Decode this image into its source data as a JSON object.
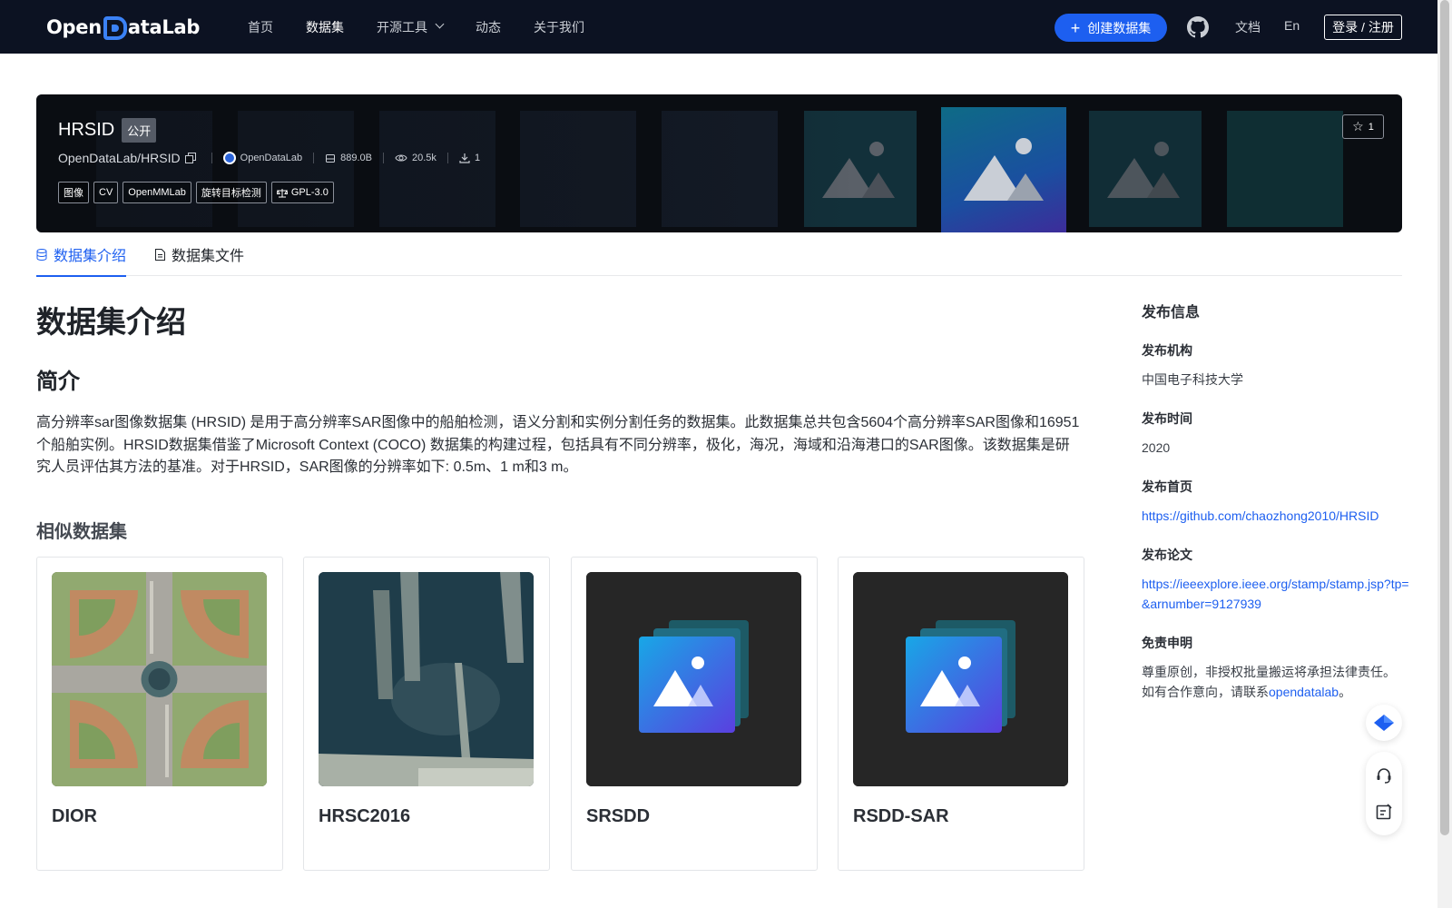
{
  "nav": {
    "logo_text_left": "Open",
    "logo_text_right": "ataLab",
    "links": [
      "首页",
      "数据集",
      "开源工具",
      "动态",
      "关于我们"
    ],
    "create_button": "创建数据集",
    "docs": "文档",
    "lang": "En",
    "login": "登录 / 注册"
  },
  "dataset": {
    "name": "HRSID",
    "visibility": "公开",
    "repo": "OpenDataLab/HRSID",
    "org": "OpenDataLab",
    "size": "889.0B",
    "views": "20.5k",
    "downloads": "1",
    "tags": [
      "图像",
      "CV",
      "OpenMMLab",
      "旋转目标检测"
    ],
    "license": "GPL-3.0",
    "stars": "1"
  },
  "tabs": [
    "数据集介绍",
    "数据集文件"
  ],
  "content": {
    "title": "数据集介绍",
    "section_title": "简介",
    "intro": "高分辨率sar图像数据集 (HRSID) 是用于高分辨率SAR图像中的船舶检测，语义分割和实例分割任务的数据集。此数据集总共包含5604个高分辨率SAR图像和16951个船舶实例。HRSID数据集借鉴了Microsoft Context (COCO) 数据集的构建过程，包括具有不同分辨率，极化，海况，海域和沿海港口的SAR图像。该数据集是研究人员评估其方法的基准。对于HRSID，SAR图像的分辨率如下: 0.5m、1 m和3 m。",
    "similar_title": "相似数据集",
    "similar": [
      {
        "name": "DIOR"
      },
      {
        "name": "HRSC2016"
      },
      {
        "name": "SRSDD"
      },
      {
        "name": "RSDD-SAR"
      }
    ]
  },
  "sidebar": {
    "heading": "发布信息",
    "org_label": "发布机构",
    "org_value": "中国电子科技大学",
    "time_label": "发布时间",
    "time_value": "2020",
    "home_label": "发布首页",
    "home_value": "https://github.com/chaozhong2010/HRSID",
    "paper_label": "发布论文",
    "paper_value": "https://ieeexplore.ieee.org/stamp/stamp.jsp?tp=&arnumber=9127939",
    "disclaimer_label": "免责申明",
    "disclaimer_line1": "尊重原创，非授权批量搬运将承担法律责任。",
    "disclaimer_line2_prefix": "如有合作意向，请联系",
    "disclaimer_link": "opendatalab",
    "disclaimer_suffix": "。"
  },
  "colors": {
    "nav_bg": "#0c1222",
    "accent": "#1d5ff0",
    "banner_bg": "#0a0d12"
  }
}
